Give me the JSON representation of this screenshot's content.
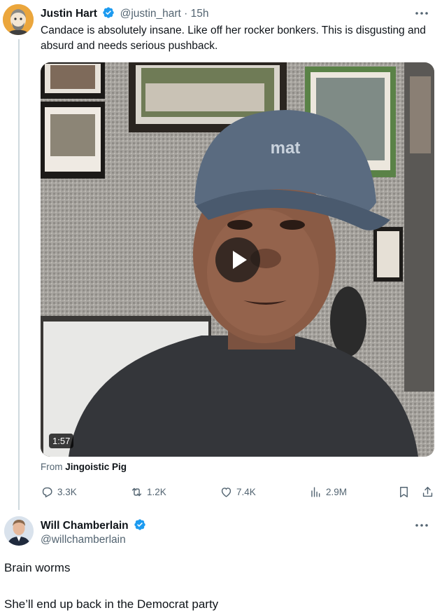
{
  "tweet1": {
    "author_name": "Justin Hart",
    "handle": "@justin_hart",
    "separator": "·",
    "time": "15h",
    "text": "Candace is absolutely insane. Like off her rocker bonkers. This is disgusting and absurd and needs serious pushback.",
    "video": {
      "duration": "1:57",
      "hat_text": "mat"
    },
    "source_prefix": "From",
    "source_name": "Jingoistic Pig",
    "actions": {
      "replies": "3.3K",
      "reposts": "1.2K",
      "likes": "7.4K",
      "views": "2.9M"
    }
  },
  "tweet2": {
    "author_name": "Will Chamberlain",
    "handle": "@willchamberlain",
    "lines": [
      "Brain worms",
      "She’ll end up back in the Democrat party"
    ]
  },
  "colors": {
    "verified_blue": "#1d9bf0",
    "secondary_text": "#536471",
    "thread_line": "#cfd9de"
  },
  "icons": [
    "more-icon",
    "verified-icon",
    "play-icon",
    "reply-icon",
    "repost-icon",
    "like-icon",
    "views-icon",
    "bookmark-icon",
    "share-icon"
  ]
}
